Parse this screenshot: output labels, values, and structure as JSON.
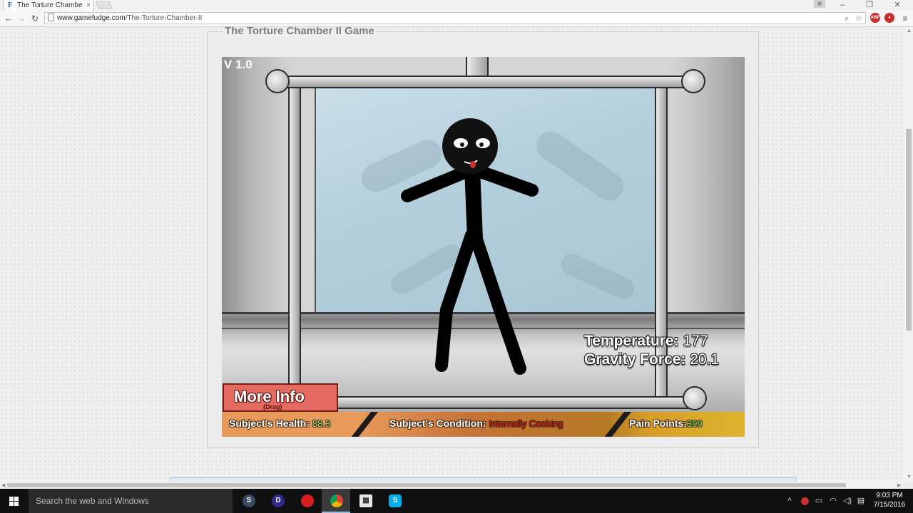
{
  "browser": {
    "tab_title": "The Torture Chambe",
    "tab_favicon": "F",
    "tab_close": "×",
    "url_domain": "www.gamefudge.com",
    "url_path": "/The-Torture-Chamber-II"
  },
  "page": {
    "game_heading": "The Torture Chamber II Game"
  },
  "game": {
    "version": "V 1.0",
    "temperature_label": "Temperature:",
    "temperature_value": "177",
    "gravity_label": "Gravity Force:",
    "gravity_value": "20.1",
    "more_info_label": "More Info",
    "drag_hint": "(Drag)",
    "health_label": "Subject's Health:",
    "health_value": "88.3",
    "condition_label": "Subject's Condition:",
    "condition_value": "Internally Cooking",
    "pain_label": "Pain Points:",
    "pain_value": "399",
    "colors": {
      "health_value": "#8fe07a",
      "condition_value": "#d11a1a",
      "pain_value": "#6fe05e"
    }
  },
  "taskbar": {
    "search_placeholder": "Search the web and Windows",
    "time": "9:03 PM",
    "date": "7/15/2016",
    "apps": [
      "steam-icon",
      "app-icon",
      "record-icon",
      "chrome-icon",
      "file-explorer-icon",
      "skype-icon"
    ]
  }
}
